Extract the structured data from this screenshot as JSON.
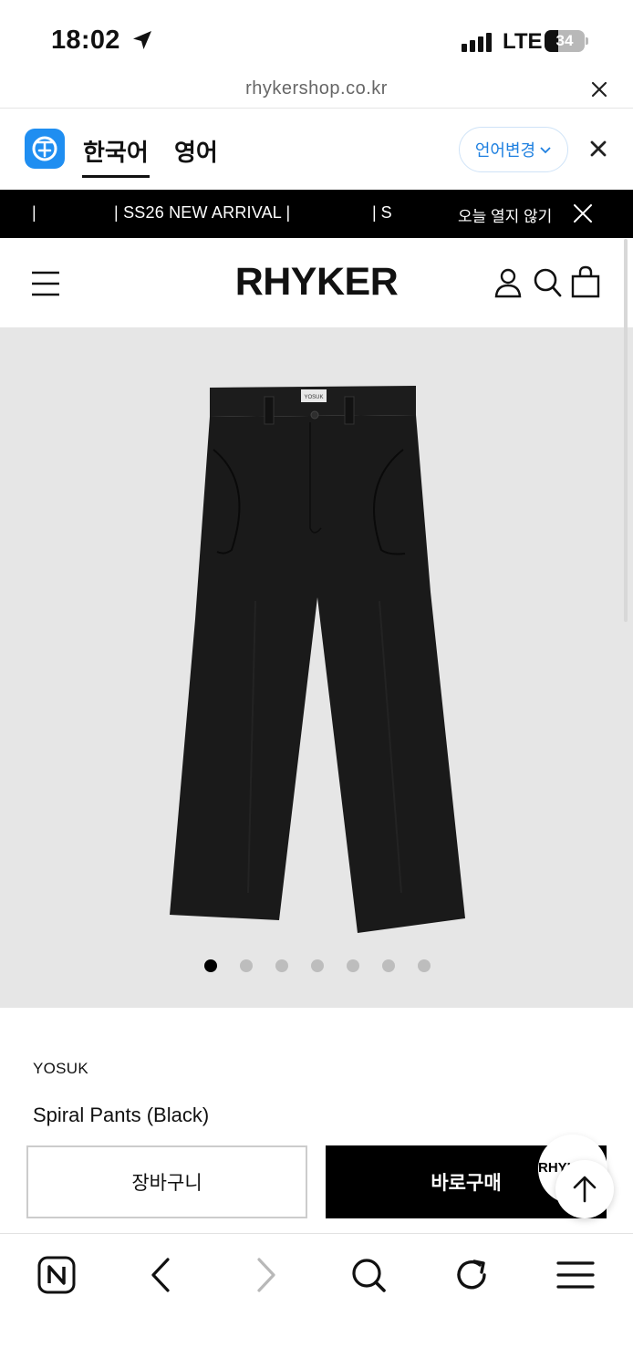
{
  "status_bar": {
    "time": "18:02",
    "network": "LTE",
    "battery": "34"
  },
  "url_bar": {
    "url": "rhykershop.co.kr"
  },
  "translate_bar": {
    "lang_current": "한국어",
    "lang_target": "영어",
    "change_label": "언어변경"
  },
  "ticker": {
    "divider_left": "|",
    "message": "| SS26 NEW ARRIVAL |",
    "divider_right": "| S",
    "dismiss_label": "오늘 열지 않기"
  },
  "header": {
    "brand": "RHYKER"
  },
  "gallery": {
    "image_label": "YOSUK",
    "slide_count": 7,
    "active_slide": 1
  },
  "product": {
    "brand": "YOSUK",
    "name": "Spiral Pants (Black)"
  },
  "actions": {
    "cart_label": "장바구니",
    "buy_label": "바로구매",
    "chat_label": "RHYKER"
  },
  "icons": [
    "location-arrow-icon",
    "close-icon",
    "translate-logo-icon",
    "chevron-down-icon",
    "hamburger-menu-icon",
    "user-icon",
    "search-icon",
    "shopping-bag-icon",
    "arrow-up-icon",
    "naver-n-icon",
    "back-icon",
    "forward-icon",
    "refresh-icon"
  ],
  "colors": {
    "accent_blue": "#1f8ef1",
    "ticker_bg": "#000000",
    "gallery_bg": "#e6e6e6",
    "buy_bg": "#000000"
  }
}
